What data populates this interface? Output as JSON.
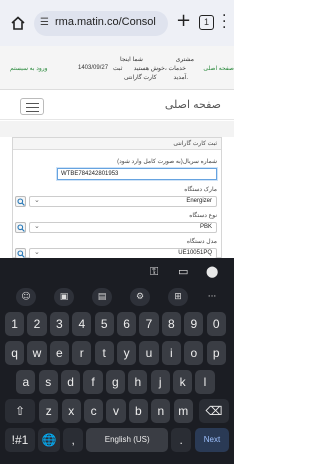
{
  "browser": {
    "url": "rma.matin.co/Consol",
    "tab_count": "1",
    "tabs_icon": "tab-switcher-icon",
    "home_icon": "home-icon",
    "site_settings_icon": "site-settings-icon",
    "new_tab_icon": "plus-icon",
    "menu_icon": "vertical-dots-icon"
  },
  "top_strip": {
    "home_link": "صفحه اصلی",
    "line1": "مشتری",
    "line2": "خدمات ،خوش هستید",
    "line3": "آمدید.",
    "shoma_inja": "شما اینجا",
    "svc": "ثبت",
    "warranty_card": "کارت گارانتی",
    "date": "1403/09/27",
    "enter_system": "ورود به سیستم"
  },
  "header": {
    "title": "صفحه اصلی"
  },
  "form": {
    "panel_title": "ثبت کارت گارانتی",
    "serial_label": "شماره سریال(به صورت کامل وارد شود)",
    "serial_value": "WTBE784242801953",
    "brand_label": "مارک دستگاه",
    "brand_value": "Energizer",
    "type_label": "نوع دستگاه",
    "type_value": "PBK",
    "model_label": "مدل دستگاه",
    "model_value": "UE10051PQ"
  },
  "keyboard": {
    "toolbar_icons": [
      "key-icon",
      "card-icon",
      "location-icon"
    ],
    "suggestion_icons": [
      "emoji-icon",
      "sticker-icon",
      "clipboard-icon",
      "settings-icon",
      "translate-icon",
      "more-icon"
    ],
    "number_row": [
      "1",
      "2",
      "3",
      "4",
      "5",
      "6",
      "7",
      "8",
      "9",
      "0"
    ],
    "row1": [
      "q",
      "w",
      "e",
      "r",
      "t",
      "y",
      "u",
      "i",
      "o",
      "p"
    ],
    "row2": [
      "a",
      "s",
      "d",
      "f",
      "g",
      "h",
      "j",
      "k",
      "l"
    ],
    "row3": [
      "z",
      "x",
      "c",
      "v",
      "b",
      "n",
      "m"
    ],
    "shift": "⇧",
    "backspace": "⌫",
    "symbols": "!#1",
    "globe": "🌐",
    "comma": ",",
    "space": "English (US)",
    "period": ".",
    "next": "Next"
  }
}
